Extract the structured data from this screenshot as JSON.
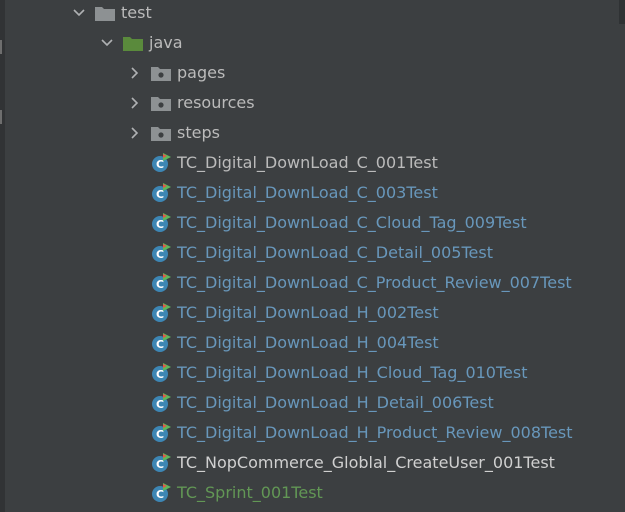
{
  "tree": {
    "test_folder": {
      "label": "test",
      "expanded": true,
      "icon": "folder-icon"
    },
    "java_folder": {
      "label": "java",
      "expanded": true,
      "icon": "source-root-folder-icon",
      "color": "#629755"
    },
    "packages": [
      {
        "label": "pages",
        "expanded": false,
        "icon": "package-icon"
      },
      {
        "label": "resources",
        "expanded": false,
        "icon": "package-icon"
      },
      {
        "label": "steps",
        "expanded": false,
        "icon": "package-icon"
      }
    ],
    "classes": [
      {
        "label": "TC_Digital_DownLoad_C_001Test",
        "status": "unmodified",
        "color": "#bbbbbb",
        "icon": "test-class-icon"
      },
      {
        "label": "TC_Digital_DownLoad_C_003Test",
        "status": "modified",
        "color": "#6897bb",
        "icon": "test-class-icon"
      },
      {
        "label": "TC_Digital_DownLoad_C_Cloud_Tag_009Test",
        "status": "modified",
        "color": "#6897bb",
        "icon": "test-class-icon"
      },
      {
        "label": "TC_Digital_DownLoad_C_Detail_005Test",
        "status": "modified",
        "color": "#6897bb",
        "icon": "test-class-icon"
      },
      {
        "label": "TC_Digital_DownLoad_C_Product_Review_007Test",
        "status": "modified",
        "color": "#6897bb",
        "icon": "test-class-icon"
      },
      {
        "label": "TC_Digital_DownLoad_H_002Test",
        "status": "modified",
        "color": "#6897bb",
        "icon": "test-class-icon"
      },
      {
        "label": "TC_Digital_DownLoad_H_004Test",
        "status": "modified",
        "color": "#6897bb",
        "icon": "test-class-icon"
      },
      {
        "label": "TC_Digital_DownLoad_H_Cloud_Tag_010Test",
        "status": "modified",
        "color": "#6897bb",
        "icon": "test-class-icon"
      },
      {
        "label": "TC_Digital_DownLoad_H_Detail_006Test",
        "status": "modified",
        "color": "#6897bb",
        "icon": "test-class-icon"
      },
      {
        "label": "TC_Digital_DownLoad_H_Product_Review_008Test",
        "status": "modified",
        "color": "#6897bb",
        "icon": "test-class-icon"
      },
      {
        "label": "TC_NopCommerce_Globlal_CreateUser_001Test",
        "status": "unmodified",
        "color": "#d0d0d0",
        "icon": "test-class-icon"
      },
      {
        "label": "TC_Sprint_001Test",
        "status": "added",
        "color": "#629755",
        "icon": "test-class-icon"
      }
    ]
  }
}
